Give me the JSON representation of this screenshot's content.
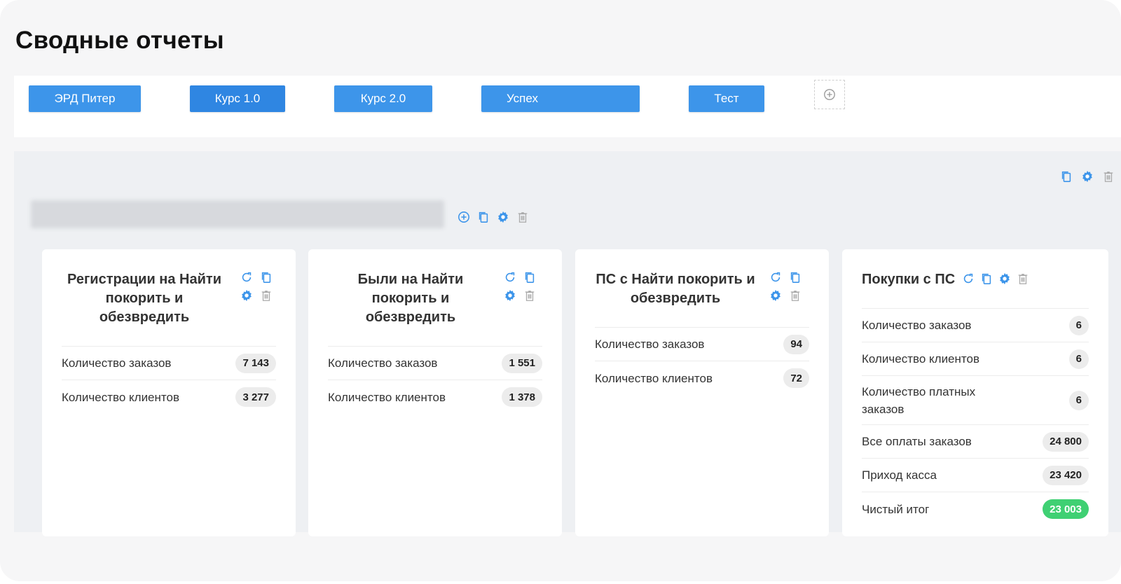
{
  "page": {
    "title": "Сводные отчеты"
  },
  "tabs": [
    {
      "label": "ЭРД Питер"
    },
    {
      "label": "Курс 1.0"
    },
    {
      "label": "Курс 2.0"
    },
    {
      "label": "Успех"
    },
    {
      "label": "Тест"
    }
  ],
  "group": {
    "title": ""
  },
  "colors": {
    "accent": "#3d95ea",
    "badge": "#ececec",
    "positive": "#3fd073"
  },
  "icons": [
    "refresh-icon",
    "copy-icon",
    "gear-icon",
    "trash-icon",
    "plus-circle-icon"
  ],
  "cards": [
    {
      "title": "Регистрации на Найти покорить и обезвредить",
      "metrics": [
        {
          "label": "Количество заказов",
          "value": "7 143"
        },
        {
          "label": "Количество клиентов",
          "value": "3 277"
        }
      ]
    },
    {
      "title": "Были на Найти покорить и обезвредить",
      "metrics": [
        {
          "label": "Количество заказов",
          "value": "1 551"
        },
        {
          "label": "Количество клиентов",
          "value": "1 378"
        }
      ]
    },
    {
      "title": "ПС с Найти покорить и обезвредить",
      "metrics": [
        {
          "label": "Количество заказов",
          "value": "94"
        },
        {
          "label": "Количество клиентов",
          "value": "72"
        }
      ]
    },
    {
      "title": "Покупки с ПС",
      "metrics": [
        {
          "label": "Количество заказов",
          "value": "6"
        },
        {
          "label": "Количество клиентов",
          "value": "6"
        },
        {
          "label": "Количество платных заказов",
          "value": "6"
        },
        {
          "label": "Все оплаты заказов",
          "value": "24 800"
        },
        {
          "label": "Приход касса",
          "value": "23 420"
        },
        {
          "label": "Чистый итог",
          "value": "23 003"
        }
      ]
    }
  ]
}
